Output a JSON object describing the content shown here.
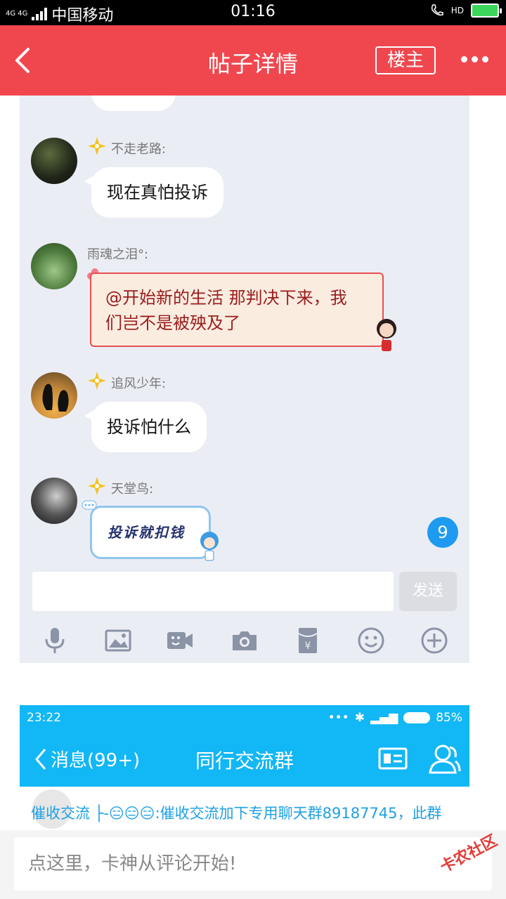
{
  "status_bar": {
    "network": "4G 4G",
    "carrier": "中国移动",
    "time": "01:16",
    "hd": "HD"
  },
  "nav": {
    "title": "帖子详情",
    "owner_button": "楼主"
  },
  "chat": {
    "messages": [
      {
        "user": "不走老路:",
        "text": "现在真怕投诉"
      },
      {
        "user": "雨魂之泪°:",
        "text_line1": "@开始新的生活 那判决下来，我",
        "text_line2": "们岂不是被殃及了"
      },
      {
        "user": "追风少年:",
        "text": "投诉怕什么"
      },
      {
        "user": "天堂鸟:",
        "text": "投诉就扣钱"
      }
    ],
    "unread_badge": "9",
    "send_label": "发送",
    "tools": [
      "mic-icon",
      "image-icon",
      "video-icon",
      "camera-icon",
      "redpacket-icon",
      "emoji-icon",
      "plus-icon"
    ]
  },
  "qq": {
    "time": "23:22",
    "battery": "85%",
    "back_label": "消息(99+)",
    "group_name": "同行交流群",
    "message": "催收交流 ├-😑😑😑:催收交流加下专用聊天群89187745，此群"
  },
  "comment": {
    "placeholder": "点这里，卡神从评论开始!",
    "watermark": "卡农社区"
  },
  "colors": {
    "nav_red": "#f0474f",
    "qq_blue": "#12b7f5",
    "chat_bg": "#ebedf5"
  }
}
